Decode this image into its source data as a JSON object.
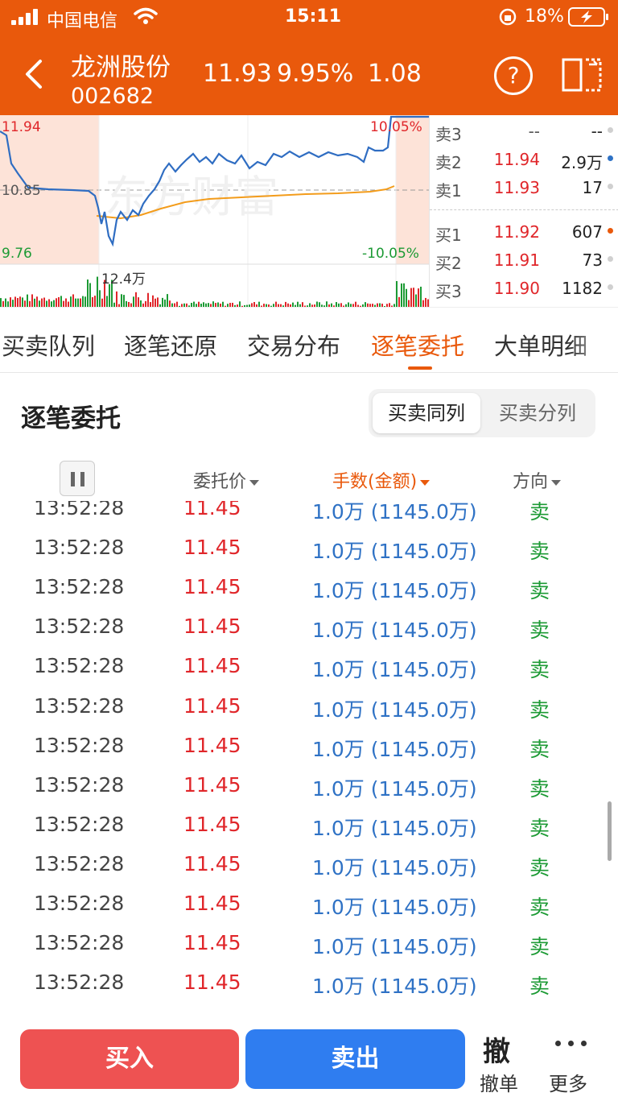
{
  "status_bar": {
    "carrier": "中国电信",
    "time": "15:11",
    "battery": "18%"
  },
  "stock": {
    "name": "龙洲股份",
    "code": "002682",
    "price": "11.93",
    "change_pct": "9.95%",
    "change": "1.08"
  },
  "chart": {
    "high_label": "11.94",
    "prev_close_label": "10.85",
    "low_label": "9.76",
    "up_pct_label": "10.05%",
    "down_pct_label": "-10.05%",
    "volume_label": "12.4万"
  },
  "order_book": {
    "asks": [
      {
        "label": "卖3",
        "price": "--",
        "volume": "--",
        "dot": "#d0d0d0"
      },
      {
        "label": "卖2",
        "price": "11.94",
        "volume": "2.9万",
        "dot": "#2f72c5"
      },
      {
        "label": "卖1",
        "price": "11.93",
        "volume": "17",
        "dot": "#d0d0d0"
      }
    ],
    "bids": [
      {
        "label": "买1",
        "price": "11.92",
        "volume": "607",
        "dot": "#e9590c"
      },
      {
        "label": "买2",
        "price": "11.91",
        "volume": "73",
        "dot": "#d0d0d0"
      },
      {
        "label": "买3",
        "price": "11.90",
        "volume": "1182",
        "dot": "#d0d0d0"
      }
    ]
  },
  "tabs": [
    "买卖队列",
    "逐笔还原",
    "交易分布",
    "逐笔委托",
    "大单明细"
  ],
  "section": {
    "title": "逐笔委托",
    "seg_on": "买卖同列",
    "seg_off": "买卖分列"
  },
  "table_header": {
    "price": "委托价",
    "amount": "手数(金额)",
    "direction": "方向"
  },
  "rows": [
    {
      "time": "13:52:28",
      "price": "11.45",
      "amount": "1.0万 (1145.0万)",
      "dir": "卖"
    },
    {
      "time": "13:52:28",
      "price": "11.45",
      "amount": "1.0万 (1145.0万)",
      "dir": "卖"
    },
    {
      "time": "13:52:28",
      "price": "11.45",
      "amount": "1.0万 (1145.0万)",
      "dir": "卖"
    },
    {
      "time": "13:52:28",
      "price": "11.45",
      "amount": "1.0万 (1145.0万)",
      "dir": "卖"
    },
    {
      "time": "13:52:28",
      "price": "11.45",
      "amount": "1.0万 (1145.0万)",
      "dir": "卖"
    },
    {
      "time": "13:52:28",
      "price": "11.45",
      "amount": "1.0万 (1145.0万)",
      "dir": "卖"
    },
    {
      "time": "13:52:28",
      "price": "11.45",
      "amount": "1.0万 (1145.0万)",
      "dir": "卖"
    },
    {
      "time": "13:52:28",
      "price": "11.45",
      "amount": "1.0万 (1145.0万)",
      "dir": "卖"
    },
    {
      "time": "13:52:28",
      "price": "11.45",
      "amount": "1.0万 (1145.0万)",
      "dir": "卖"
    },
    {
      "time": "13:52:28",
      "price": "11.45",
      "amount": "1.0万 (1145.0万)",
      "dir": "卖"
    },
    {
      "time": "13:52:28",
      "price": "11.45",
      "amount": "1.0万 (1145.0万)",
      "dir": "卖"
    },
    {
      "time": "13:52:28",
      "price": "11.45",
      "amount": "1.0万 (1145.0万)",
      "dir": "卖"
    },
    {
      "time": "13:52:28",
      "price": "11.45",
      "amount": "1.0万 (1145.0万)",
      "dir": "卖"
    }
  ],
  "bottom": {
    "buy": "买入",
    "sell": "卖出",
    "cancel_icon": "撤",
    "cancel": "撤单",
    "more": "更多"
  },
  "colors": {
    "brand": "#e9590c",
    "up": "#e0262a",
    "down": "#1c9a34",
    "amount": "#2f72c5",
    "buy": "#ee5252",
    "sell": "#2f7df0"
  }
}
